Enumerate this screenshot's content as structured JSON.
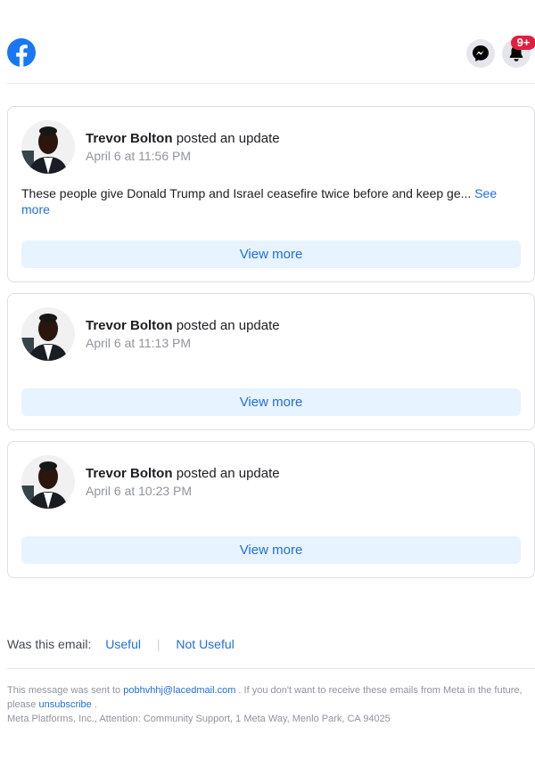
{
  "header": {
    "logo_icon": "facebook-logo-icon",
    "messenger_icon": "messenger-icon",
    "notifications_icon": "bell-icon",
    "notification_badge": "9+",
    "brand_color": "#1877f2",
    "badge_color": "#e41e3f"
  },
  "posts": [
    {
      "author": "Trevor Bolton",
      "action": "posted an update",
      "timestamp": "April 6 at 11:56 PM",
      "text": "These people give Donald Trump and Israel ceasefire twice before and keep ge...",
      "see_more": "See more",
      "view_more": "View more"
    },
    {
      "author": "Trevor Bolton",
      "action": "posted an update",
      "timestamp": "April 6 at 11:13 PM",
      "view_more": "View more"
    },
    {
      "author": "Trevor Bolton",
      "action": "posted an update",
      "timestamp": "April 6 at 10:23 PM",
      "view_more": "View more"
    }
  ],
  "feedback": {
    "question": "Was this email:",
    "useful": "Useful",
    "separator": "|",
    "not_useful": "Not Useful"
  },
  "footer": {
    "prefix": "This message was sent to",
    "email": "pobhvhhj@lacedmail.com",
    "middle": ". If you don't want to receive these emails from Meta in the future, please",
    "unsubscribe": "unsubscribe",
    "suffix": ".",
    "address": "Meta Platforms, Inc., Attention: Community Support, 1 Meta Way, Menlo Park, CA 94025"
  }
}
